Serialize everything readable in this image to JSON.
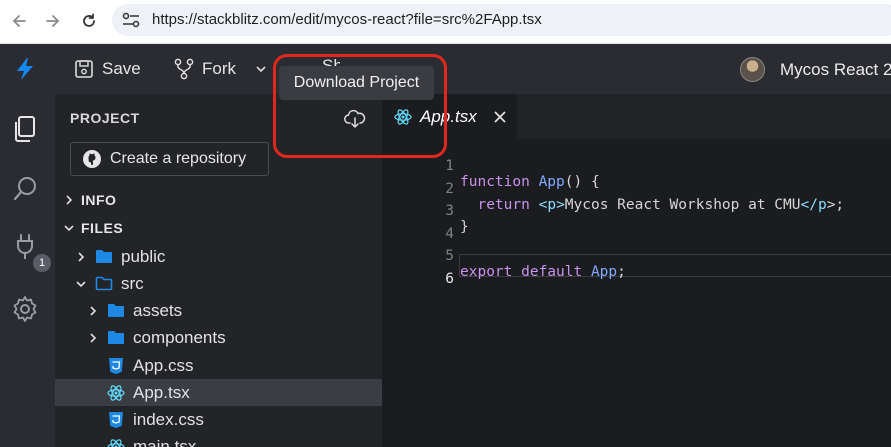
{
  "browser": {
    "url": "https://stackblitz.com/edit/mycos-react?file=src%2FApp.tsx"
  },
  "toolbar": {
    "save_label": "Save",
    "fork_label": "Fork",
    "share_label_partial": "Sh",
    "project_name": "Mycos React 2"
  },
  "tooltip": {
    "text": "Download Project"
  },
  "activity": {
    "badge_count": "1"
  },
  "sidebar": {
    "title": "PROJECT",
    "create_repo_label": "Create a repository",
    "sections": [
      {
        "label": "INFO"
      },
      {
        "label": "FILES"
      }
    ],
    "tree": [
      {
        "label": "public",
        "type": "folder"
      },
      {
        "label": "src",
        "type": "folder-open"
      },
      {
        "label": "assets",
        "type": "folder"
      },
      {
        "label": "components",
        "type": "folder"
      },
      {
        "label": "App.css",
        "type": "css-file"
      },
      {
        "label": "App.tsx",
        "type": "react-file"
      },
      {
        "label": "index.css",
        "type": "css-file"
      },
      {
        "label": "main.tsx",
        "type": "react-file"
      }
    ]
  },
  "editor": {
    "tab_label": "App.tsx",
    "line_numbers": [
      "1",
      "2",
      "3",
      "4",
      "5",
      "6"
    ],
    "code": {
      "l1_kw": "function",
      "l1_name": "App",
      "l1_rest": "() {",
      "l2_kw": "return",
      "l2_open": "<",
      "l2_tag": "p",
      "l2_gt": ">",
      "l2_text": "Mycos React Workshop at CMU",
      "l2_close_open": "</",
      "l2_close_tag": "p",
      "l2_close_end": ">;",
      "l3": "}",
      "l5_kw": "export default",
      "l5_name": "App",
      "l5_end": ";"
    }
  },
  "colors": {
    "highlight_border": "#e3261e",
    "keyword": "#c792ea",
    "identifier": "#82aaff",
    "jsx_tag": "#89ddff",
    "brand_blue": "#1389fd"
  }
}
